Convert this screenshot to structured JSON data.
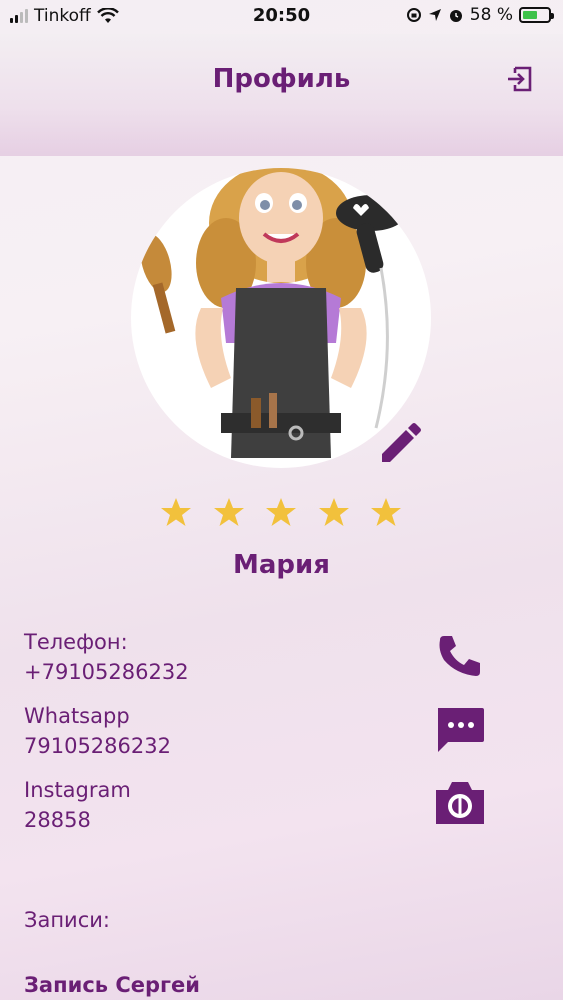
{
  "status_bar": {
    "carrier": "Tinkoff",
    "time": "20:50",
    "battery_percent": "58 %"
  },
  "header": {
    "title": "Профиль",
    "logout_icon": "logout-icon"
  },
  "profile": {
    "name": "Мария",
    "rating": 5,
    "rating_max": 5
  },
  "contacts": {
    "phone": {
      "label": "Телефон:",
      "value": "+79105286232",
      "icon": "phone-icon"
    },
    "whatsapp": {
      "label": "Whatsapp",
      "value": "79105286232",
      "icon": "chat-icon"
    },
    "instagram": {
      "label": "Instagram",
      "value": "28858",
      "icon": "camera-icon"
    }
  },
  "records": {
    "label": "Записи:",
    "items": [
      "Запись Сергей"
    ]
  },
  "colors": {
    "accent": "#6a1f75",
    "star": "#f2c13c"
  }
}
